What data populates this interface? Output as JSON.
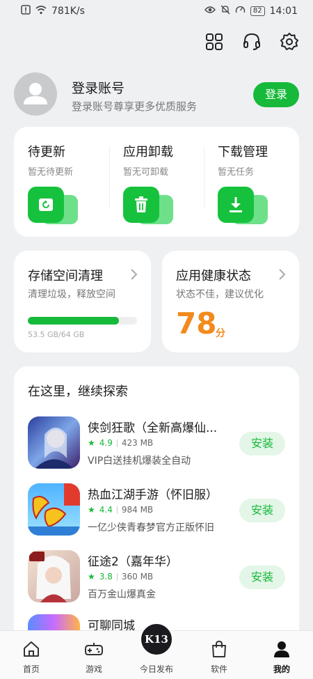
{
  "status_bar": {
    "speed": "781K/s",
    "battery": "82",
    "time": "14:01"
  },
  "account": {
    "title": "登录账号",
    "subtitle": "登录账号尊享更多优质服务",
    "login_label": "登录"
  },
  "quick_actions": [
    {
      "title": "待更新",
      "subtitle": "暂无待更新",
      "icon": "update-icon"
    },
    {
      "title": "应用卸载",
      "subtitle": "暂无可卸载",
      "icon": "trash-icon"
    },
    {
      "title": "下载管理",
      "subtitle": "暂无任务",
      "icon": "download-icon"
    }
  ],
  "storage": {
    "title": "存储空间清理",
    "subtitle": "清理垃圾，释放空间",
    "usage": "53.5 GB/64 GB",
    "used_fraction": 0.836
  },
  "health": {
    "title": "应用健康状态",
    "subtitle": "状态不佳，建议优化",
    "score": "78",
    "unit": "分"
  },
  "explore": {
    "title": "在这里，继续探索",
    "apps": [
      {
        "name": "侠剑狂歌（全新高爆仙...",
        "rating": "4.9",
        "size": "423 MB",
        "desc": "VIP白送挂机爆装全自动",
        "install": "安装"
      },
      {
        "name": "热血江湖手游（怀旧服）",
        "rating": "4.4",
        "size": "984 MB",
        "desc": "一亿少侠青春梦官方正版怀旧",
        "install": "安装"
      },
      {
        "name": "征途2（嘉年华）",
        "rating": "3.8",
        "size": "360 MB",
        "desc": "百万金山爆真金",
        "install": "安装"
      },
      {
        "name": "可聊同城",
        "rating": "",
        "size": "",
        "desc": "",
        "install": ""
      }
    ]
  },
  "tabs": [
    {
      "label": "首页",
      "icon": "home-icon"
    },
    {
      "label": "游戏",
      "icon": "gamepad-icon"
    },
    {
      "label": "今日发布",
      "icon": "today-badge-icon",
      "badge": "K13"
    },
    {
      "label": "软件",
      "icon": "shopping-bag-icon"
    },
    {
      "label": "我的",
      "icon": "person-icon"
    }
  ],
  "colors": {
    "accent": "#16b93a",
    "score": "#f28a1d",
    "background": "#eff0f2"
  }
}
